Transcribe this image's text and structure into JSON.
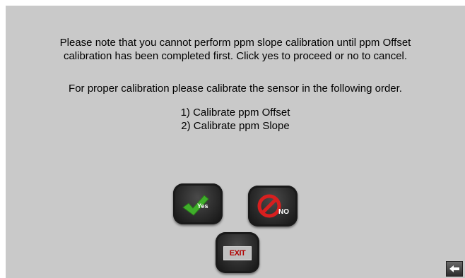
{
  "message": {
    "line1": "Please note that you cannot perform ppm slope calibration until ppm Offset",
    "line2": "calibration has been completed first. Click yes to proceed or no to cancel.",
    "line3": "For proper calibration please calibrate the sensor in the following order."
  },
  "steps": [
    "1) Calibrate ppm Offset",
    "2) Calibrate ppm Slope"
  ],
  "buttons": {
    "yes_label": "Yes",
    "no_label": "NO",
    "exit_label": "EXIT"
  },
  "icons": {
    "yes": "check-icon",
    "no": "no-entry-icon",
    "back": "back-arrow-icon"
  },
  "colors": {
    "background": "#c9c9c9",
    "check": "#3fae2a",
    "no_symbol": "#d81f1f",
    "exit_text": "#b00000"
  }
}
